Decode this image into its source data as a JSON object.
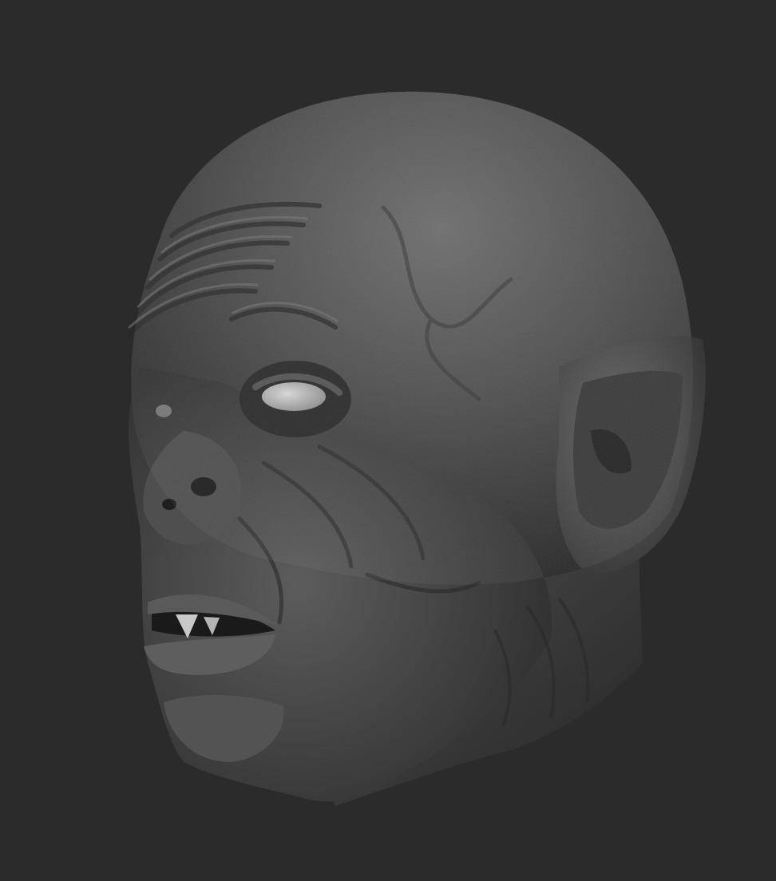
{
  "scene": {
    "subject": "sculpt-render",
    "colors": {
      "background": "#2b2b2b",
      "skin_base": "#4a4a4a",
      "skin_light": "#6c6c6c",
      "skin_shadow": "#262626",
      "eye": "#bdbdbd",
      "tooth": "#c8c8c8"
    }
  }
}
